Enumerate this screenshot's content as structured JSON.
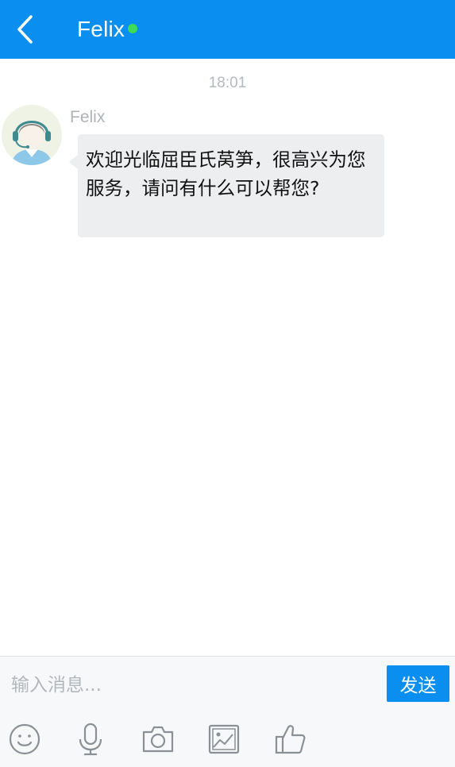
{
  "header": {
    "title": "Felix",
    "online": true,
    "accent_color": "#0a8ff0",
    "online_color": "#3ddc53"
  },
  "chat": {
    "timestamp": "18:01",
    "messages": [
      {
        "sender": "Felix",
        "avatar_icon": "headset-agent-avatar",
        "text": "欢迎光临屈臣氏莴笋，很高兴为您服务，请问有什么可以帮您?"
      }
    ]
  },
  "input": {
    "placeholder": "输入消息...",
    "value": "",
    "send_label": "发送"
  },
  "toolbar": {
    "icons": [
      "emoji-icon",
      "microphone-icon",
      "camera-icon",
      "image-icon",
      "thumbs-up-icon"
    ]
  }
}
